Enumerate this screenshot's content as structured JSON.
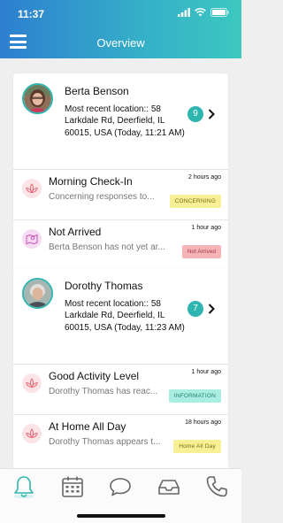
{
  "status_bar": {
    "time": "11:37"
  },
  "header": {
    "title": "Overview"
  },
  "residents": [
    {
      "name": "Berta Benson",
      "location": "Most recent location:: 58 Larkdale Rd, Deerfield, IL 60015, USA (Today, 11:21 AM)",
      "alert_count": "9",
      "alerts": [
        {
          "title": "Morning Check-In",
          "time": "2 hours ago",
          "description": "Concerning responses to...",
          "tag": "CONCERNING",
          "tag_color": "#f8f095",
          "icon": "lotus-icon"
        },
        {
          "title": "Not Arrived",
          "time": "1 hour ago",
          "description": "Berta Benson has not yet ar...",
          "tag": "Not Arrived",
          "tag_color": "#f6b4b9",
          "icon": "map-pin-icon"
        }
      ]
    },
    {
      "name": "Dorothy Thomas",
      "location": "Most recent location:: 58 Larkdale Rd, Deerfield, IL 60015, USA (Today, 11:23 AM)",
      "alert_count": "7",
      "alerts": [
        {
          "title": "Good Activity Level",
          "time": "1 hour ago",
          "description": "Dorothy Thomas has reac...",
          "tag": "INFORMATION",
          "tag_color": "#a9eee1",
          "icon": "lotus-icon"
        },
        {
          "title": "At Home All Day",
          "time": "18 hours ago",
          "description": "Dorothy Thomas appears t...",
          "tag": "Home All Day",
          "tag_color": "#f8f095",
          "icon": "lotus-icon"
        }
      ]
    }
  ],
  "tab_bar": {
    "tabs": [
      {
        "icon": "bell-icon",
        "active": true
      },
      {
        "icon": "calendar-icon",
        "active": false
      },
      {
        "icon": "chat-bubble-icon",
        "active": false
      },
      {
        "icon": "inbox-tray-icon",
        "active": false
      },
      {
        "icon": "phone-icon",
        "active": false
      }
    ]
  },
  "colors": {
    "accent": "#2fb5b0",
    "header_start": "#2d7fd0",
    "header_end": "#3cc8c0"
  }
}
